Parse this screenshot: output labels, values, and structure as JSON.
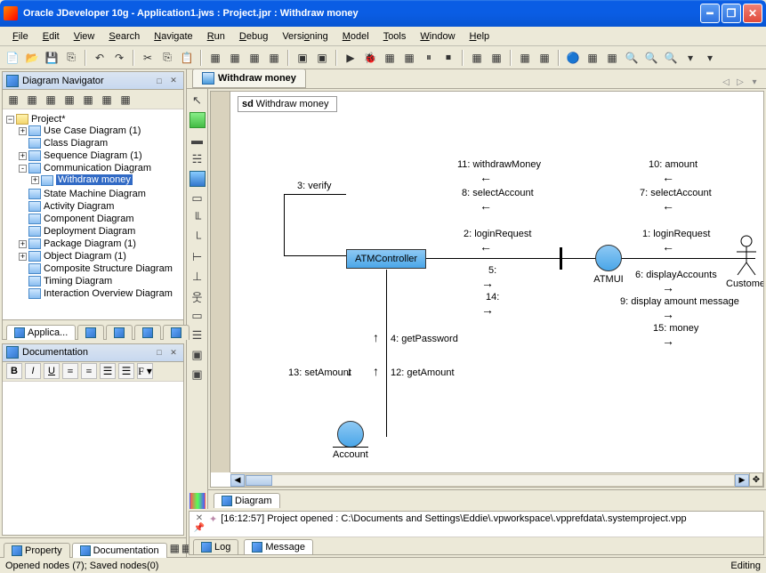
{
  "window": {
    "title": "Oracle JDeveloper 10g - Application1.jws : Project.jpr : Withdraw money"
  },
  "menu": {
    "items": [
      "File",
      "Edit",
      "View",
      "Search",
      "Navigate",
      "Run",
      "Debug",
      "Versioning",
      "Model",
      "Tools",
      "Window",
      "Help"
    ]
  },
  "diagramNavigator": {
    "title": "Diagram Navigator",
    "root": "Project*",
    "items": [
      {
        "label": "Use Case Diagram (1)",
        "exp": "+"
      },
      {
        "label": "Class Diagram",
        "exp": ""
      },
      {
        "label": "Sequence Diagram (1)",
        "exp": "+"
      },
      {
        "label": "Communication Diagram",
        "exp": "-",
        "children": [
          {
            "label": "Withdraw money",
            "selected": true,
            "exp": "+"
          }
        ]
      },
      {
        "label": "State Machine Diagram",
        "exp": ""
      },
      {
        "label": "Activity Diagram",
        "exp": ""
      },
      {
        "label": "Component Diagram",
        "exp": ""
      },
      {
        "label": "Deployment Diagram",
        "exp": ""
      },
      {
        "label": "Package Diagram (1)",
        "exp": "+"
      },
      {
        "label": "Object Diagram (1)",
        "exp": "+"
      },
      {
        "label": "Composite Structure Diagram",
        "exp": ""
      },
      {
        "label": "Timing Diagram",
        "exp": ""
      },
      {
        "label": "Interaction Overview Diagram",
        "exp": ""
      }
    ],
    "bottomTabs": [
      "Applica...",
      "",
      ""
    ]
  },
  "documentation": {
    "title": "Documentation"
  },
  "editor": {
    "tabTitle": "Withdraw money",
    "sdLabel": "sd",
    "sdTitle": "Withdraw money",
    "bottomTab": "Diagram"
  },
  "diagram": {
    "nodes": {
      "atmController": "ATMController",
      "atmui": "ATMUI",
      "account": "Account",
      "customer": "Customer"
    },
    "messages": {
      "m1": "1: loginRequest",
      "m2": "2: loginRequest",
      "m3": "3: verify",
      "m4": "4: getPassword",
      "m5": "5:",
      "m6": "6: displayAccounts",
      "m7": "7: selectAccount",
      "m8": "8: selectAccount",
      "m9": "9: display amount message",
      "m10": "10: amount",
      "m11": "11: withdrawMoney",
      "m12": "12: getAmount",
      "m13": "13: setAmount",
      "m14": "14:",
      "m15": "15: money"
    }
  },
  "console": {
    "message": "[16:12:57]  Project opened : C:\\Documents and Settings\\Eddie\\.vpworkspace\\.vpprefdata\\.systemproject.vpp",
    "tabs": [
      "Log",
      "Message"
    ]
  },
  "leftBottomTabs": [
    "Property",
    "Documentation"
  ],
  "status": {
    "left": "Opened nodes (7); Saved nodes(0)",
    "right": "Editing"
  }
}
